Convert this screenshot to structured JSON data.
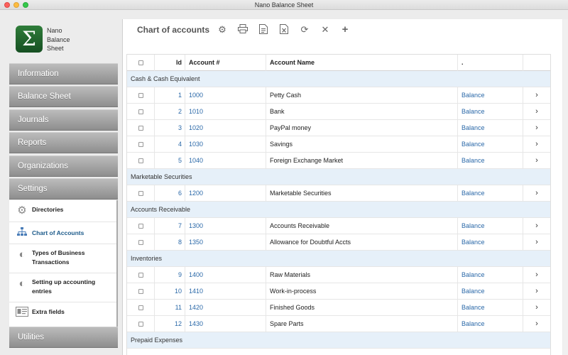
{
  "window": {
    "title": "Nano Balance Sheet"
  },
  "logo": {
    "glyph": "Σ",
    "line1": "Nano",
    "line2": "Balance",
    "line3": "Sheet"
  },
  "nav": {
    "information": "Information",
    "balance_sheet": "Balance Sheet",
    "journals": "Journals",
    "reports": "Reports",
    "organizations": "Organizations",
    "settings": "Settings",
    "utilities": "Utilities"
  },
  "settings_menu": {
    "directories": "Directories",
    "chart_of_accounts": "Chart of Accounts",
    "types_of_business": "Types of Business Transactions",
    "setting_up": "Setting up accounting entries",
    "extra_fields": "Extra fields"
  },
  "toolbar": {
    "title": "Chart of accounts",
    "icons": [
      "gear-icon",
      "print-icon",
      "document-icon",
      "excel-icon",
      "refresh-icon",
      "close-icon",
      "plus-icon"
    ]
  },
  "table": {
    "headers": {
      "id": "Id",
      "account": "Account #",
      "name": "Account Name",
      "dot": ".",
      "arrow": ""
    },
    "groups": {
      "cash": "Cash & Cash Equivalent",
      "marketable": "Marketable Securities",
      "receivable": "Accounts Receivable",
      "inventories": "Inventories",
      "prepaid": "Prepaid Expenses"
    },
    "rows": [
      {
        "id": "1",
        "account": "1000",
        "name": "Petty Cash",
        "link": "Balance"
      },
      {
        "id": "2",
        "account": "1010",
        "name": "Bank",
        "link": "Balance"
      },
      {
        "id": "3",
        "account": "1020",
        "name": "PayPal money",
        "link": "Balance"
      },
      {
        "id": "4",
        "account": "1030",
        "name": "Savings",
        "link": "Balance"
      },
      {
        "id": "5",
        "account": "1040",
        "name": "Foreign Exchange Market",
        "link": "Balance"
      },
      {
        "id": "6",
        "account": "1200",
        "name": "Marketable Securities",
        "link": "Balance"
      },
      {
        "id": "7",
        "account": "1300",
        "name": "Accounts Receivable",
        "link": "Balance"
      },
      {
        "id": "8",
        "account": "1350",
        "name": "Allowance for Doubtful Accts",
        "link": "Balance"
      },
      {
        "id": "9",
        "account": "1400",
        "name": "Raw Materials",
        "link": "Balance"
      },
      {
        "id": "10",
        "account": "1410",
        "name": "Work-in-process",
        "link": "Balance"
      },
      {
        "id": "11",
        "account": "1420",
        "name": "Finished Goods",
        "link": "Balance"
      },
      {
        "id": "12",
        "account": "1430",
        "name": "Spare Parts",
        "link": "Balance"
      }
    ],
    "arrow": "›"
  }
}
